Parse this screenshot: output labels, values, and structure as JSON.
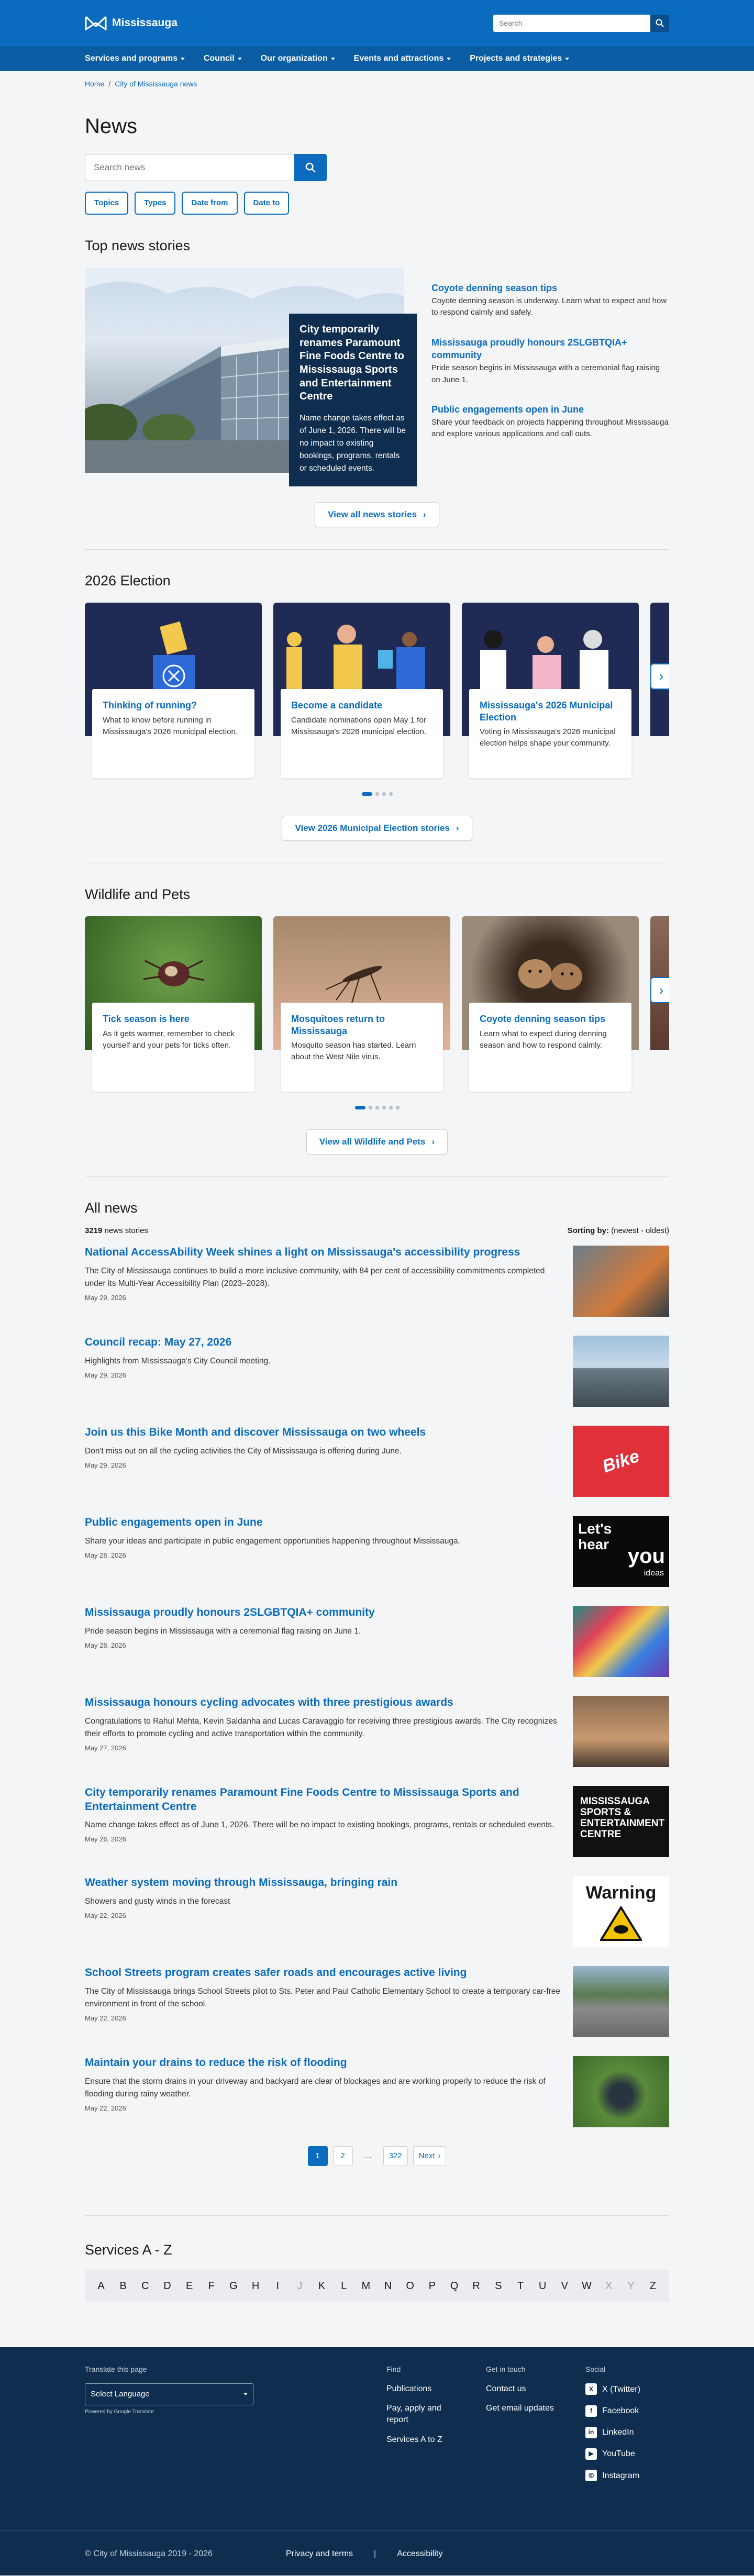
{
  "header": {
    "logo_text": "Mississauga",
    "search_placeholder": "Search",
    "nav": [
      "Services and programs",
      "Council",
      "Our organization",
      "Events and attractions",
      "Projects and strategies"
    ]
  },
  "breadcrumb": [
    "Home",
    "City of Mississauga news"
  ],
  "page": {
    "title": "News",
    "search_placeholder": "Search news",
    "filters": [
      "Topics",
      "Types",
      "Date from",
      "Date to"
    ]
  },
  "top_stories": {
    "heading": "Top news stories",
    "featured": {
      "title": "City temporarily renames Paramount Fine Foods Centre to Mississauga Sports and Entertainment Centre",
      "desc": "Name change takes effect as of June 1, 2026. There will be no impact to existing bookings, programs, rentals or scheduled events."
    },
    "side": [
      {
        "title": "Coyote denning season tips",
        "desc": "Coyote denning season is underway. Learn what to expect and how to respond calmly and safely."
      },
      {
        "title": "Mississauga proudly honours 2SLGBTQIA+ community",
        "desc": "Pride season begins in Mississauga with a ceremonial flag raising on June 1."
      },
      {
        "title": "Public engagements open in June",
        "desc": "Share your feedback on projects happening throughout Mississauga and explore various applications and call outs."
      }
    ],
    "view_all": "View all news stories"
  },
  "election": {
    "heading": "2026 Election",
    "cards": [
      {
        "title": "Thinking of running?",
        "desc": "What to know before running in Mississauga's 2026 municipal election."
      },
      {
        "title": "Become a candidate",
        "desc": "Candidate nominations open May 1 for Mississauga's 2026 municipal election."
      },
      {
        "title": "Mississauga's 2026 Municipal Election",
        "desc": "Voting in Mississauga's 2026 municipal election helps shape your community."
      }
    ],
    "view_all": "View 2026 Municipal Election stories"
  },
  "wildlife": {
    "heading": "Wildlife and Pets",
    "cards": [
      {
        "title": "Tick season is here",
        "desc": "As it gets warmer, remember to check yourself and your pets for ticks often."
      },
      {
        "title": "Mosquitoes return to Mississauga",
        "desc": "Mosquito season has started. Learn about the West Nile virus."
      },
      {
        "title": "Coyote denning season tips",
        "desc": "Learn what to expect during denning season and how to respond calmly."
      }
    ],
    "view_all": "View all Wildlife and Pets"
  },
  "all_news": {
    "heading": "All news",
    "count": "3219",
    "count_label": "news stories",
    "sort_label": "Sorting by:",
    "sort_value": "(newest - oldest)",
    "items": [
      {
        "title": "National AccessAbility Week shines a light on Mississauga's accessibility progress",
        "desc": "The City of Mississauga continues to build a more inclusive community, with 84 per cent of accessibility commitments completed under its Multi-Year Accessibility Plan (2023–2028).",
        "date": "May 29, 2026"
      },
      {
        "title": "Council recap: May 27, 2026",
        "desc": "Highlights from Mississauga's City Council meeting.",
        "date": "May 29, 2026"
      },
      {
        "title": "Join us this Bike Month and discover Mississauga on two wheels",
        "desc": "Don't miss out on all the cycling activities the City of Mississauga is offering during June.",
        "date": "May 29, 2026"
      },
      {
        "title": "Public engagements open in June",
        "desc": "Share your ideas and participate in public engagement opportunities happening throughout Mississauga.",
        "date": "May 28, 2026"
      },
      {
        "title": "Mississauga proudly honours 2SLGBTQIA+ community",
        "desc": "Pride season begins in Mississauga with a ceremonial flag raising on June 1.",
        "date": "May 28, 2026"
      },
      {
        "title": "Mississauga honours cycling advocates with three prestigious awards",
        "desc": "Congratulations to Rahul Mehta, Kevin Saldanha and Lucas Caravaggio for receiving three prestigious awards. The City recognizes their efforts to promote cycling and active transportation within the community.",
        "date": "May 27, 2026"
      },
      {
        "title": "City temporarily renames Paramount Fine Foods Centre to Mississauga Sports and Entertainment Centre",
        "desc": "Name change takes effect as of June 1, 2026. There will be no impact to existing bookings, programs, rentals or scheduled events.",
        "date": "May 26, 2026"
      },
      {
        "title": "Weather system moving through Mississauga, bringing rain",
        "desc": "Showers and gusty winds in the forecast",
        "date": "May 22, 2026"
      },
      {
        "title": "School Streets program creates safer roads and encourages active living",
        "desc": "The City of Mississauga brings School Streets pilot to Sts. Peter and Paul Catholic Elementary School to create a temporary car-free environment in front of the school.",
        "date": "May 22, 2026"
      },
      {
        "title": "Maintain your drains to reduce the risk of flooding",
        "desc": "Ensure that the storm drains in your driveway and backyard are clear of blockages and are working properly to reduce the risk of flooding during rainy weather.",
        "date": "May 22, 2026"
      }
    ],
    "image_text": {
      "bike": "Bike",
      "lets1": "Let's",
      "lets2": "hear",
      "lets3": "you",
      "lets4": "ideas",
      "msec": "MISSISSAUGA SPORTS & ENTERTAINMENT CENTRE",
      "warning": "Warning"
    },
    "pager": {
      "pages": [
        "1",
        "2",
        "…",
        "322"
      ],
      "next": "Next"
    }
  },
  "services_az": {
    "heading": "Services A - Z",
    "letters": [
      "A",
      "B",
      "C",
      "D",
      "E",
      "F",
      "G",
      "H",
      "I",
      "J",
      "K",
      "L",
      "M",
      "N",
      "O",
      "P",
      "Q",
      "R",
      "S",
      "T",
      "U",
      "V",
      "W",
      "X",
      "Y",
      "Z"
    ]
  },
  "footer": {
    "translate_label": "Translate this page",
    "select_language": "Select Language",
    "powered_by": "Powered by Google Translate",
    "find": {
      "heading": "Find",
      "links": [
        "Publications",
        "Pay, apply and report",
        "Services A to Z"
      ]
    },
    "touch": {
      "heading": "Get in touch",
      "links": [
        "Contact us",
        "Get email updates"
      ]
    },
    "social": {
      "heading": "Social",
      "links": [
        "X (Twitter)",
        "Facebook",
        "LinkedIn",
        "YouTube",
        "Instagram"
      ]
    },
    "copyright": "© City of Mississauga 2019 - 2026",
    "privacy": "Privacy and terms",
    "accessibility": "Accessibility"
  }
}
